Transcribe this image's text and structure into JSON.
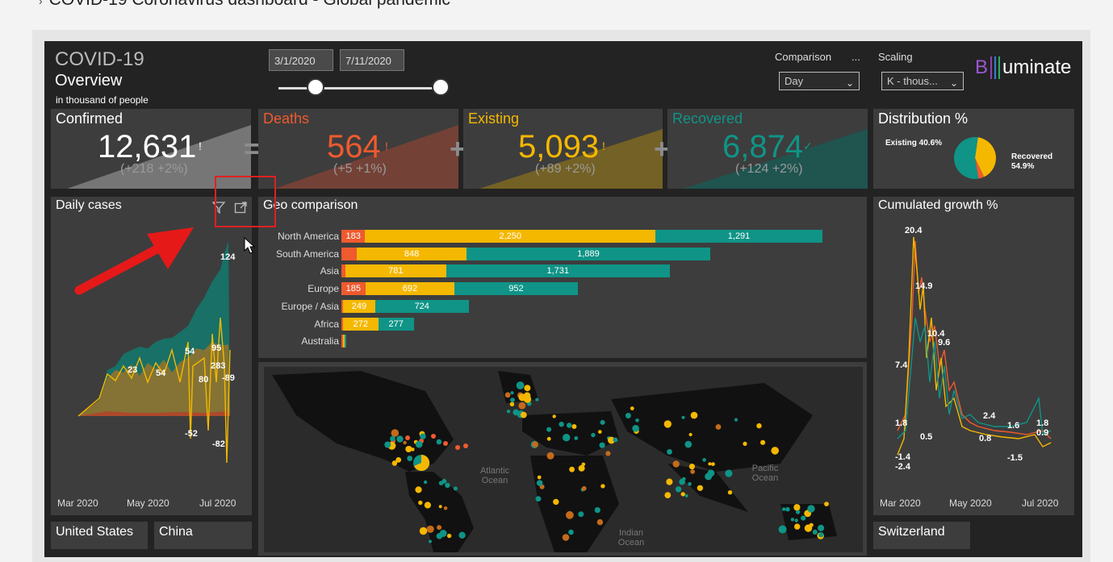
{
  "page": {
    "title": "COVID-19 Coronavirus dashboard - Global pandemic"
  },
  "header": {
    "title_line1": "COVID-19",
    "title_line2": "Overview",
    "subtitle": "in thousand of people",
    "date_start": "3/1/2020",
    "date_end": "7/11/2020",
    "comparison_label": "Comparison",
    "more_label": "...",
    "comparison_value": "Day",
    "scaling_label": "Scaling",
    "scaling_value": "K - thous...",
    "brand_b": "B",
    "brand_rest": "uminate"
  },
  "kpis": {
    "confirmed": {
      "label": "Confirmed",
      "value": "12,631",
      "flag": "!",
      "delta": "(+218 +2%)",
      "color": "#ffffff"
    },
    "deaths": {
      "label": "Deaths",
      "value": "564",
      "flag": "!",
      "delta": "(+5 +1%)",
      "color": "#ef5a2f"
    },
    "existing": {
      "label": "Existing",
      "value": "5,093",
      "flag": "!",
      "delta": "(+89 +2%)",
      "color": "#f5b800"
    },
    "recovered": {
      "label": "Recovered",
      "value": "6,874",
      "flag": "✓",
      "delta": "(+124 +2%)",
      "color": "#0f9487"
    }
  },
  "operators": {
    "equals": "=",
    "plus": "+"
  },
  "distribution": {
    "title": "Distribution %",
    "existing_label": "Existing 40.6%",
    "recovered_label_1": "Recovered",
    "recovered_label_2": "54.9%"
  },
  "daily_cases": {
    "title": "Daily cases",
    "x_ticks": [
      "Mar 2020",
      "May 2020",
      "Jul 2020"
    ],
    "labels": [
      "124",
      "54",
      "95",
      "23",
      "54",
      "283",
      "80",
      "-89",
      "-52",
      "-82"
    ]
  },
  "geo": {
    "title": "Geo comparison",
    "ocean_atlantic": "Atlantic Ocean",
    "ocean_pacific": "Pacific Ocean",
    "ocean_indian": "Indian Ocean"
  },
  "cumulated": {
    "title": "Cumulated growth %",
    "x_ticks": [
      "Mar 2020",
      "May 2020",
      "Jul 2020"
    ],
    "labels": [
      "20.4",
      "14.9",
      "10.4",
      "9.6",
      "7.4",
      "1.8",
      "0.5",
      "-1.4",
      "-2.4",
      "2.4",
      "1.6",
      "1.8",
      "0.9",
      "0.8",
      "-1.5"
    ]
  },
  "country_tiles": {
    "us": "United States",
    "china": "China",
    "switzerland": "Switzerland"
  },
  "chart_data": [
    {
      "type": "bar",
      "title": "Geo comparison",
      "categories": [
        "North America",
        "South America",
        "Asia",
        "Europe",
        "Europe / Asia",
        "Africa",
        "Australia"
      ],
      "series": [
        {
          "name": "Deaths",
          "color": "#ef5a2f",
          "values": [
            183,
            120,
            30,
            185,
            8,
            6,
            1
          ]
        },
        {
          "name": "Existing",
          "color": "#f5b800",
          "values": [
            2250,
            848,
            781,
            692,
            249,
            272,
            1
          ]
        },
        {
          "name": "Recovered",
          "color": "#0f9487",
          "values": [
            1291,
            1889,
            1731,
            952,
            724,
            277,
            8
          ]
        }
      ],
      "data_labels": [
        [
          "183",
          "2,250",
          "1,291"
        ],
        [
          "",
          "848",
          "1,889"
        ],
        [
          "",
          "781",
          "1,731"
        ],
        [
          "185",
          "692",
          "952"
        ],
        [
          "",
          "249",
          "724"
        ],
        [
          "",
          "272",
          "277"
        ],
        [
          "",
          "",
          ""
        ]
      ]
    },
    {
      "type": "pie",
      "title": "Distribution %",
      "categories": [
        "Existing",
        "Recovered",
        "Deaths"
      ],
      "values": [
        40.6,
        54.9,
        4.5
      ],
      "colors": [
        "#f5b800",
        "#0f9487",
        "#ef5a2f"
      ]
    }
  ]
}
